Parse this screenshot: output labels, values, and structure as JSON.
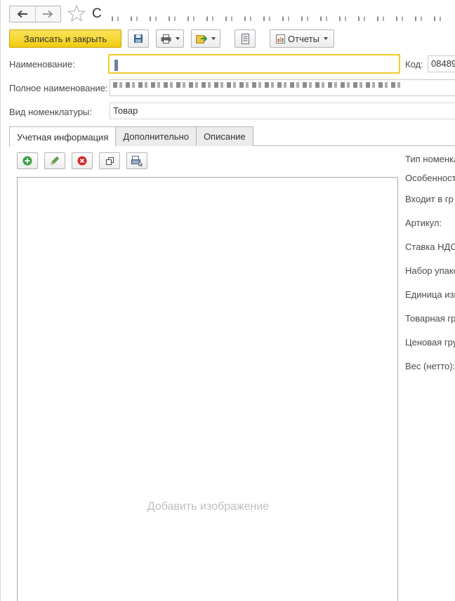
{
  "title": {
    "text": "С"
  },
  "toolbar": {
    "save_close_label": "Записать и закрыть",
    "reports_label": "Отчеты"
  },
  "form": {
    "name_label": "Наименование:",
    "name_value": "",
    "code_label": "Код:",
    "code_value": "08489",
    "fullname_label": "Полное наименование:",
    "kind_label": "Вид номенклатуры:",
    "kind_value": "Товар"
  },
  "tabs": [
    {
      "label": "Учетная информация"
    },
    {
      "label": "Дополнительно"
    },
    {
      "label": "Описание"
    }
  ],
  "image_panel": {
    "placeholder": "Добавить изображение"
  },
  "right_labels": [
    "Тип номенкл",
    "Особенност",
    "Входит в гр",
    "Артикул:",
    "Ставка НДС",
    "Набор упако",
    "Единица изм",
    "Товарная гр",
    "Ценовая гру",
    "Вес (нетто):"
  ],
  "colors": {
    "accent_yellow": "#f2cc12",
    "focus_border": "#f0cd2e",
    "placeholder_text": "#bfbfbf"
  }
}
